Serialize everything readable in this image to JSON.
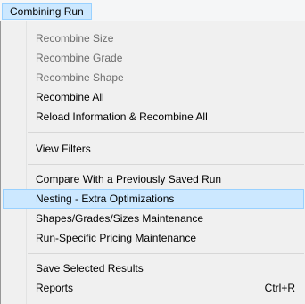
{
  "menubar": {
    "title": "Combining Run"
  },
  "menu": {
    "items": [
      {
        "label": "Recombine Size",
        "disabled": true
      },
      {
        "label": "Recombine Grade",
        "disabled": true
      },
      {
        "label": "Recombine Shape",
        "disabled": true
      },
      {
        "label": "Recombine All",
        "disabled": false
      },
      {
        "label": "Reload Information & Recombine All",
        "disabled": false
      },
      {
        "label": "View Filters",
        "disabled": false
      },
      {
        "label": "Compare With a Previously Saved Run",
        "disabled": false
      },
      {
        "label": "Nesting - Extra Optimizations",
        "disabled": false,
        "highlighted": true
      },
      {
        "label": "Shapes/Grades/Sizes Maintenance",
        "disabled": false
      },
      {
        "label": "Run-Specific Pricing Maintenance",
        "disabled": false
      },
      {
        "label": "Save Selected Results",
        "disabled": false
      },
      {
        "label": "Reports",
        "disabled": false,
        "shortcut": "Ctrl+R"
      }
    ]
  },
  "colors": {
    "highlight_bg": "#cce8ff",
    "highlight_border": "#99d1ff",
    "disabled_text": "#6d6d6d",
    "menu_bg": "#f0f0f0"
  }
}
